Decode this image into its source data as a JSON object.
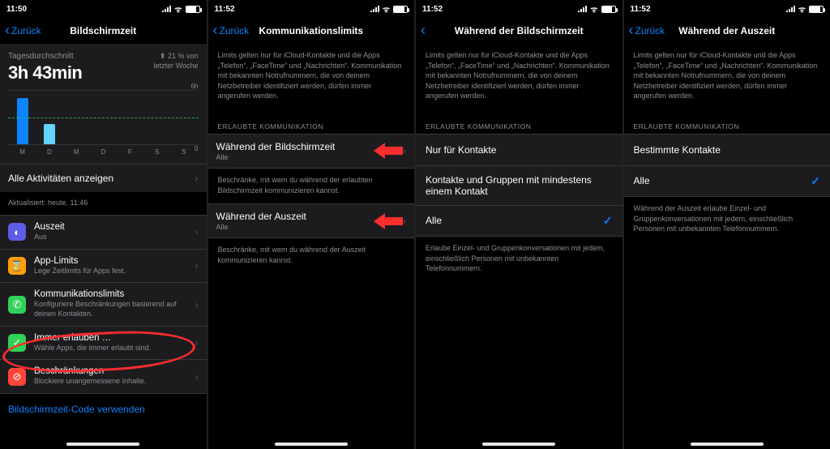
{
  "status": {
    "wifi": "􀙇",
    "lock_icon": "lock-icon"
  },
  "screens": [
    {
      "time": "11:50",
      "back": "Zurück",
      "title": "Bildschirmzeit",
      "avg": {
        "label": "Tagesdurchschnitt",
        "value": "3h 43min",
        "delta_pct": "21 % von",
        "delta_line2": "letzter Woche"
      },
      "show_all": "Alle Aktivitäten anzeigen",
      "updated": "Aktualisiert: heute, 11:46",
      "menu": [
        {
          "icon_bg": "#5e5ce6",
          "icon": "◐",
          "name": "auszeit-icon",
          "title": "Auszeit",
          "sub": "Aus"
        },
        {
          "icon_bg": "#ff9f0a",
          "icon": "⌛",
          "name": "app-limits-icon",
          "title": "App-Limits",
          "sub": "Lege Zeitlimits für Apps fest."
        },
        {
          "icon_bg": "#30d158",
          "icon": "✆",
          "name": "comm-limits-icon",
          "title": "Kommunikationslimits",
          "sub": "Konfiguriere Beschränkungen basierend auf deinen Kontakten."
        },
        {
          "icon_bg": "#30d158",
          "icon": "✓",
          "name": "always-allowed-icon",
          "title": "Immer erlauben …",
          "sub": "Wähle Apps, die immer erlaubt sind."
        },
        {
          "icon_bg": "#ff453a",
          "icon": "⊘",
          "name": "restrictions-icon",
          "title": "Beschränkungen",
          "sub": "Blockiere unangemessene Inhalte."
        }
      ],
      "link": "Bildschirmzeit-Code verwenden"
    },
    {
      "time": "11:52",
      "back": "Zurück",
      "title": "Kommunikationslimits",
      "intro": "Limits gelten nur für iCloud-Kontakte und die Apps „Telefon“, „FaceTime“ und „Nachrichten“. Kommunikation mit bekannten Notrufnummern, die von deinem Netzbetreiber identifiziert werden, dürfen immer angerufen werden.",
      "section": "ERLAUBTE KOMMUNIKATION",
      "rows": [
        {
          "title": "Während der Bildschirmzeit",
          "sub": "Alle",
          "desc": "Beschränke, mit wem du während der erlaubten Bildschirmzeit kommunizieren kannst."
        },
        {
          "title": "Während der Auszeit",
          "sub": "Alle",
          "desc": "Beschränke, mit wem du während der Auszeit kommunizieren kannst."
        }
      ]
    },
    {
      "time": "11:52",
      "back": "",
      "title": "Während der Bildschirmzeit",
      "intro": "Limits gelten nur für iCloud-Kontakte und die Apps „Telefon“, „FaceTime“ und „Nachrichten“. Kommunikation mit bekannten Notrufnummern, die von deinem Netzbetreiber identifiziert werden, dürfen immer angerufen werden.",
      "section": "ERLAUBTE KOMMUNIKATION",
      "options": [
        {
          "label": "Nur für Kontakte",
          "selected": false
        },
        {
          "label": "Kontakte und Gruppen mit mindestens einem Kontakt",
          "selected": false
        },
        {
          "label": "Alle",
          "selected": true
        }
      ],
      "footer": "Erlaube Einzel- und Gruppenkonversationen mit jedem, einschließlich Personen mit unbekannten Telefonnummern."
    },
    {
      "time": "11:52",
      "back": "Zurück",
      "title": "Während der Auszeit",
      "intro": "Limits gelten nur für iCloud-Kontakte und die Apps „Telefon“, „FaceTime“ und „Nachrichten“. Kommunikation mit bekannten Notrufnummern, die von deinem Netzbetreiber identifiziert werden, dürfen immer angerufen werden.",
      "section": "ERLAUBTE KOMMUNIKATION",
      "options": [
        {
          "label": "Bestimmte Kontakte",
          "selected": false
        },
        {
          "label": "Alle",
          "selected": true
        }
      ],
      "footer": "Während der Auszeit erlaube Einzel- und Gruppenkonversationen mit jedem, einschließlich Personen mit unbekannten Telefonnummern."
    }
  ],
  "chart_data": {
    "type": "bar",
    "categories": [
      "M",
      "D",
      "M",
      "D",
      "F",
      "S",
      "S"
    ],
    "series": [
      {
        "name": "primary",
        "color": "#0a84ff",
        "values": [
          5.2,
          0,
          0,
          0,
          0,
          0,
          0
        ]
      },
      {
        "name": "secondary",
        "color": "#64d2ff",
        "values": [
          0,
          2.3,
          0,
          0,
          0,
          0,
          0
        ]
      }
    ],
    "ylim": [
      0,
      6
    ],
    "ylabel_top": "6h",
    "ylabel_bot": "0",
    "avg_line_value": 3.72
  }
}
